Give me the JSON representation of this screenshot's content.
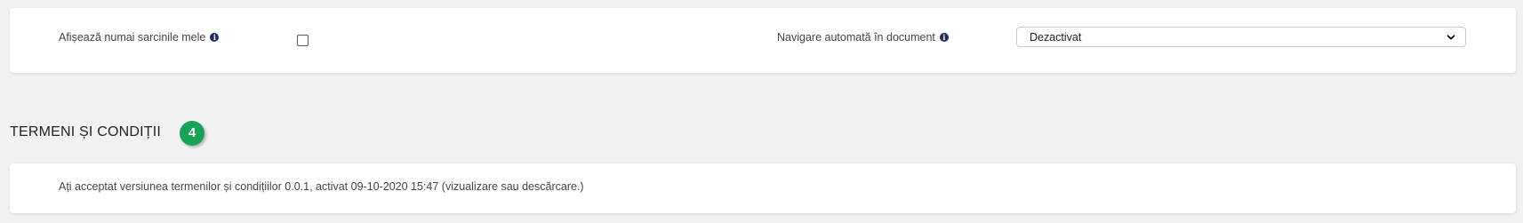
{
  "settings": {
    "my_tasks_label": "Afișează numai sarcinile mele",
    "my_tasks_checked": false,
    "auto_nav_label": "Navigare automată în document",
    "auto_nav_value": "Dezactivat"
  },
  "icons": {
    "info": "info-icon",
    "dropdown": "chevron-down-icon"
  },
  "terms": {
    "title": "TERMENI ȘI CONDIȚII",
    "badge": "4",
    "text": "Ați acceptat versiunea termenilor și condițiilor 0.0.1, activat 09-10-2020 15:47 (vizualizare sau descărcare.)"
  },
  "colors": {
    "badge": "#17a355",
    "info_icon": "#1f2d5c",
    "background": "#f2f2f2"
  }
}
